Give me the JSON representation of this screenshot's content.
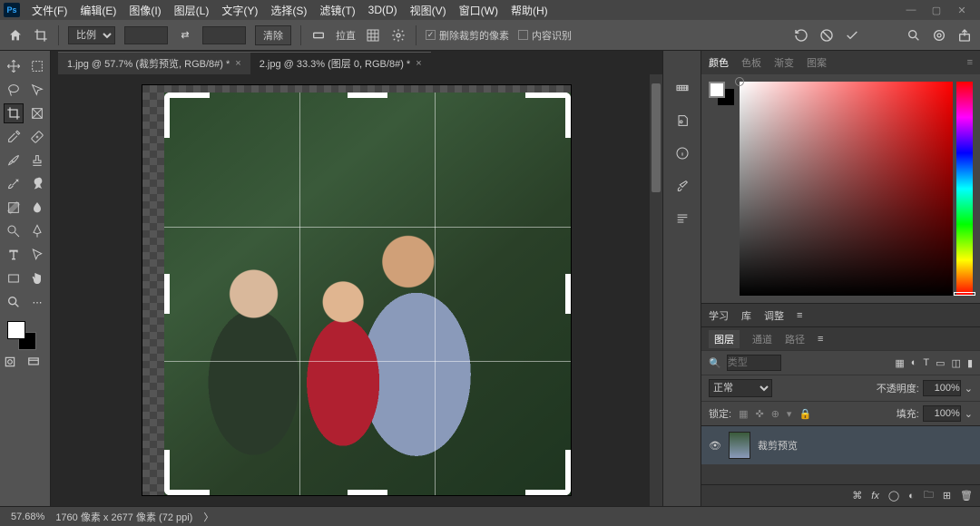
{
  "app": {
    "logo": "Ps"
  },
  "menu": [
    "文件(F)",
    "编辑(E)",
    "图像(I)",
    "图层(L)",
    "文字(Y)",
    "选择(S)",
    "滤镜(T)",
    "3D(D)",
    "视图(V)",
    "窗口(W)",
    "帮助(H)"
  ],
  "opt": {
    "ratio": "比例",
    "clear": "清除",
    "straighten": "拉直",
    "deleteCropped": "删除裁剪的像素",
    "contentAware": "内容识别"
  },
  "tabs": [
    {
      "label": "1.jpg @ 57.7% (裁剪预览, RGB/8#) *",
      "active": true
    },
    {
      "label": "2.jpg @ 33.3% (图层 0, RGB/8#) *",
      "active": false
    }
  ],
  "colorTabs": [
    "颜色",
    "色板",
    "渐变",
    "图案"
  ],
  "midTabs": [
    "学习",
    "库",
    "调整"
  ],
  "layerTabs": [
    "图层",
    "通道",
    "路径"
  ],
  "layerOpts": {
    "searchPlaceholder": "类型",
    "blend": "正常",
    "opacityLabel": "不透明度:",
    "opacity": "100%",
    "lockLabel": "锁定:",
    "fillLabel": "填充:",
    "fill": "100%"
  },
  "layers": [
    {
      "name": "裁剪预览"
    }
  ],
  "status": {
    "zoom": "57.68%",
    "dims": "1760 像素 x 2677 像素 (72 ppi)",
    "arrow": "〉"
  }
}
